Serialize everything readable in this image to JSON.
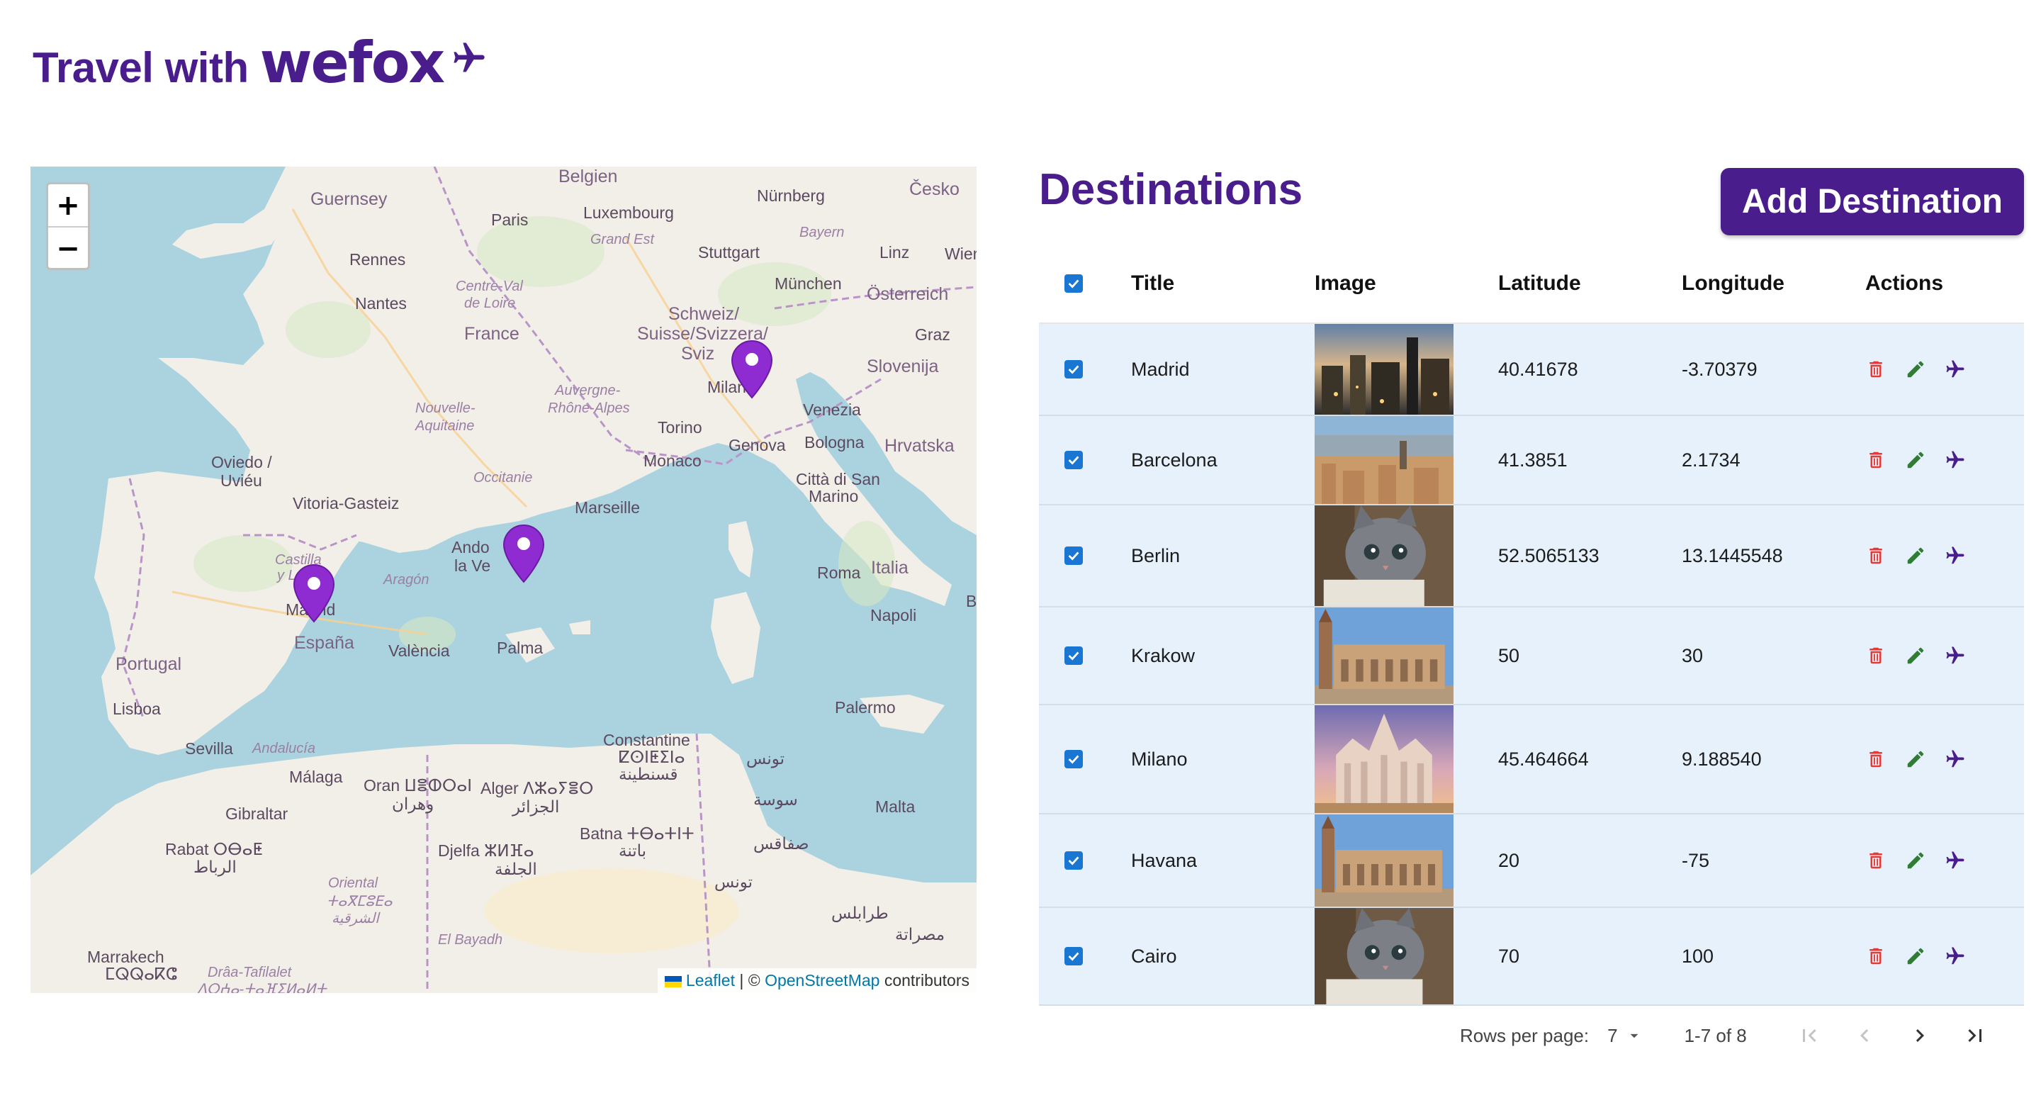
{
  "header": {
    "travel_text": "Travel with",
    "brand_text": "wefox",
    "plane_icon": "airplane-icon",
    "brand_color": "#4a1d8c"
  },
  "map": {
    "zoom_in": "+",
    "zoom_out": "−",
    "attribution": {
      "leaflet": "Leaflet",
      "separator": "| ©",
      "osm": "OpenStreetMap",
      "contributors": "contributors"
    },
    "labels": {
      "belgien": "Belgien",
      "guernsey": "Guernsey",
      "paris": "Paris",
      "luxembourg": "Luxembourg",
      "grand_est": "Grand Est",
      "nurnberg": "Nürnberg",
      "cesko": "Česko",
      "bayern": "Bayern",
      "stuttgart": "Stuttgart",
      "linz": "Linz",
      "wien": "Wier",
      "rennes": "Rennes",
      "centre_val": "Centre-Val",
      "de_loire": "de Loire",
      "munchen": "München",
      "osterreich": "Österreich",
      "nantes": "Nantes",
      "schweiz": "Schweiz/",
      "suisse": "Suisse/Svizzera/",
      "svizra": "Sviz",
      "graz": "Graz",
      "france": "France",
      "slovenija": "Slovenija",
      "nouvelle": "Nouvelle-",
      "aquitaine": "Aquitaine",
      "auvergne": "Auvergne-",
      "rhone_alpes": "Rhône-Alpes",
      "milano": "Milano",
      "venezia": "Venezia",
      "torino": "Torino",
      "genova": "Genova",
      "bologna": "Bologna",
      "hrvatska": "Hrvatska",
      "oviedo": "Oviedo /",
      "uvieu": "Uviéu",
      "occitanie": "Occitanie",
      "monaco": "Monaco",
      "citta": "Città di San",
      "marino": "Marino",
      "vitoria": "Vitoria-Gasteiz",
      "marseille": "Marseille",
      "andorra": "Ando",
      "la_vella": "la Ve",
      "castilla": "Castilla",
      "y_l": "y L",
      "aragon": "Aragón",
      "roma": "Roma",
      "italia": "Italia",
      "madrid": "Madrid",
      "napoli": "Napoli",
      "espana": "España",
      "valencia": "València",
      "palma": "Palma",
      "portugal": "Portugal",
      "lisboa": "Lisboa",
      "palermo": "Palermo",
      "sevilla": "Sevilla",
      "andalucia": "Andalucía",
      "constantine": "Constantine",
      "constantine_b": "ⵇⵙⵏⵟⵉⵏⴰ",
      "constantine_ar": "قسنطينة",
      "tunis": "تونس",
      "malaga": "Málaga",
      "oran": "Oran ⵡⴻⵀⵔⴰⵏ",
      "oran_ar": "وهران",
      "alger": "Alger ⴷⵣⴰⵢⴻⵔ",
      "alger_ar": "الجزائر",
      "sousse": "سوسة",
      "malta": "Malta",
      "gibraltar": "Gibraltar",
      "batna": "Batna ⵜⴱⴰⵜⵏⵜ",
      "batna_ar": "باتنة",
      "sfax": "صفاقس",
      "rabat": "Rabat ⵔⴱⴰⵟ",
      "rabat_ar": "الرباط",
      "djelfa": "Djelfa ⵣⵍⴼⴰ",
      "djelfa_ar": "الجلفة",
      "tunisia": "تونس",
      "oriental": "Oriental",
      "oriental_b": "ⵜⴰⴳⵎⵓⴹⴰ",
      "oriental_ar": "الشرقية",
      "tarabulus": "طرابلس",
      "misrata": "مصراتة",
      "el_bayadh": "El Bayadh",
      "marrakech": "Marrakech",
      "marrakech_b": "ⵎⵕⵕⴰⴽⵛ",
      "draa": "Drâa-Tafilalet",
      "draa_b": "ⴷⵔⵄⴰ-ⵜⴰⴼⵉⵍⴰⵍⵜ",
      "b_edge": "B"
    },
    "markers": [
      "madrid-marker",
      "barcelona-marker",
      "milano-marker"
    ],
    "marker_color": "#8e2bd1"
  },
  "destinations": {
    "title": "Destinations",
    "add_button": "Add Destination",
    "columns": {
      "title": "Title",
      "image": "Image",
      "latitude": "Latitude",
      "longitude": "Longitude",
      "actions": "Actions"
    },
    "rows": [
      {
        "title": "Madrid",
        "latitude": "40.41678",
        "longitude": "-3.70379",
        "image": "city-night-photo"
      },
      {
        "title": "Barcelona",
        "latitude": "41.3851",
        "longitude": "2.1734",
        "image": "city-skyline-photo"
      },
      {
        "title": "Berlin",
        "latitude": "52.5065133",
        "longitude": "13.1445548",
        "image": "kitten-photo"
      },
      {
        "title": "Krakow",
        "latitude": "50",
        "longitude": "30",
        "image": "cloth-hall-photo"
      },
      {
        "title": "Milano",
        "latitude": "45.464664",
        "longitude": "9.188540",
        "image": "cathedral-photo"
      },
      {
        "title": "Havana",
        "latitude": "20",
        "longitude": "-75",
        "image": "cloth-hall-photo"
      },
      {
        "title": "Cairo",
        "latitude": "70",
        "longitude": "100",
        "image": "kitten-photo"
      }
    ],
    "action_icons": [
      "delete-icon",
      "edit-icon",
      "airplane-icon"
    ],
    "action_colors": {
      "delete": "#e53935",
      "edit": "#2e7d32",
      "fly": "#4a1d8c"
    },
    "checkbox_color": "#1976d2"
  },
  "pagination": {
    "rows_per_page_label": "Rows per page:",
    "rows_per_page_value": "7",
    "range": "1-7 of 8"
  }
}
